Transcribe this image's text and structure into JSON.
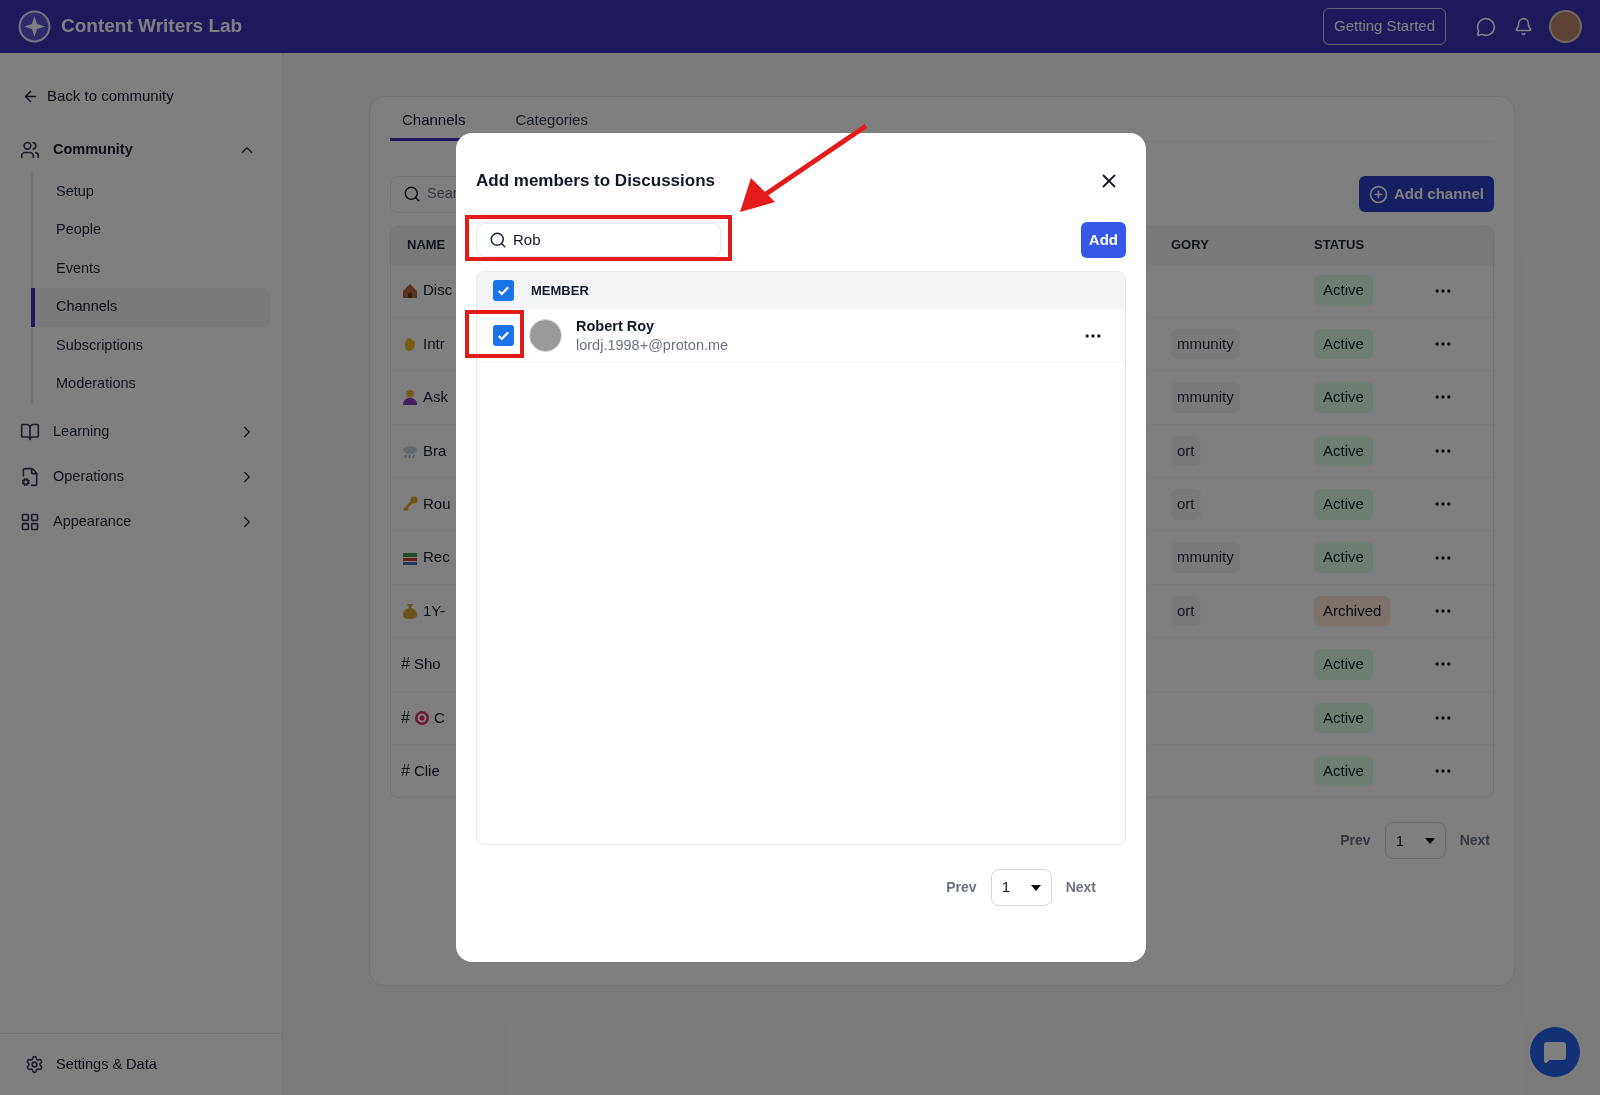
{
  "topbar": {
    "brand": "Content Writers Lab",
    "button": "Getting Started"
  },
  "sidebar": {
    "back": "Back to community",
    "sections": [
      {
        "label": "Community",
        "expanded": true,
        "children": [
          {
            "label": "Setup",
            "selected": false
          },
          {
            "label": "People",
            "selected": false
          },
          {
            "label": "Events",
            "selected": false
          },
          {
            "label": "Channels",
            "selected": true
          },
          {
            "label": "Subscriptions",
            "selected": false
          },
          {
            "label": "Moderations",
            "selected": false
          }
        ]
      },
      {
        "label": "Learning",
        "expanded": false
      },
      {
        "label": "Operations",
        "expanded": false
      },
      {
        "label": "Appearance",
        "expanded": false
      }
    ],
    "footer": "Settings & Data"
  },
  "tabs": [
    {
      "label": "Channels",
      "selected": true
    },
    {
      "label": "Categories",
      "selected": false
    }
  ],
  "search": {
    "placeholder": "Sear"
  },
  "add_channel": "Add channel",
  "table": {
    "columns": [
      "NAME",
      "GORY",
      "STATUS"
    ],
    "rows": [
      {
        "name": "Disc",
        "status": "Active",
        "kind": "active"
      },
      {
        "name": "Intr",
        "category": "mmunity",
        "status": "Active",
        "kind": "active"
      },
      {
        "name": "Ask",
        "category": "mmunity",
        "status": "Active",
        "kind": "active"
      },
      {
        "name": "Bra",
        "category": "ort",
        "status": "Active",
        "kind": "active"
      },
      {
        "name": "Rou",
        "category": "ort",
        "status": "Active",
        "kind": "active"
      },
      {
        "name": "Rec",
        "category": "mmunity",
        "status": "Active",
        "kind": "active"
      },
      {
        "name": "1Y-",
        "category": "ort",
        "status": "Archived",
        "kind": "archived"
      },
      {
        "prefix": "#",
        "name": "Sho",
        "status": "Active",
        "kind": "active"
      },
      {
        "prefix": "#",
        "name": "C",
        "status": "Active",
        "kind": "active"
      },
      {
        "prefix": "#",
        "name": "Clie",
        "status": "Active",
        "kind": "active"
      }
    ]
  },
  "pagination": {
    "prev": "Prev",
    "page": "1",
    "next": "Next"
  },
  "modal": {
    "title": "Add members to Discussions",
    "search": {
      "value": "Rob"
    },
    "add_button": "Add",
    "select_all": {
      "checked": true
    },
    "column": "MEMBER",
    "members": [
      {
        "name": "Robert Roy",
        "email": "lordj.1998+@proton.me",
        "checked": true
      }
    ],
    "pagination": {
      "prev": "Prev",
      "page": "1",
      "next": "Next"
    }
  }
}
